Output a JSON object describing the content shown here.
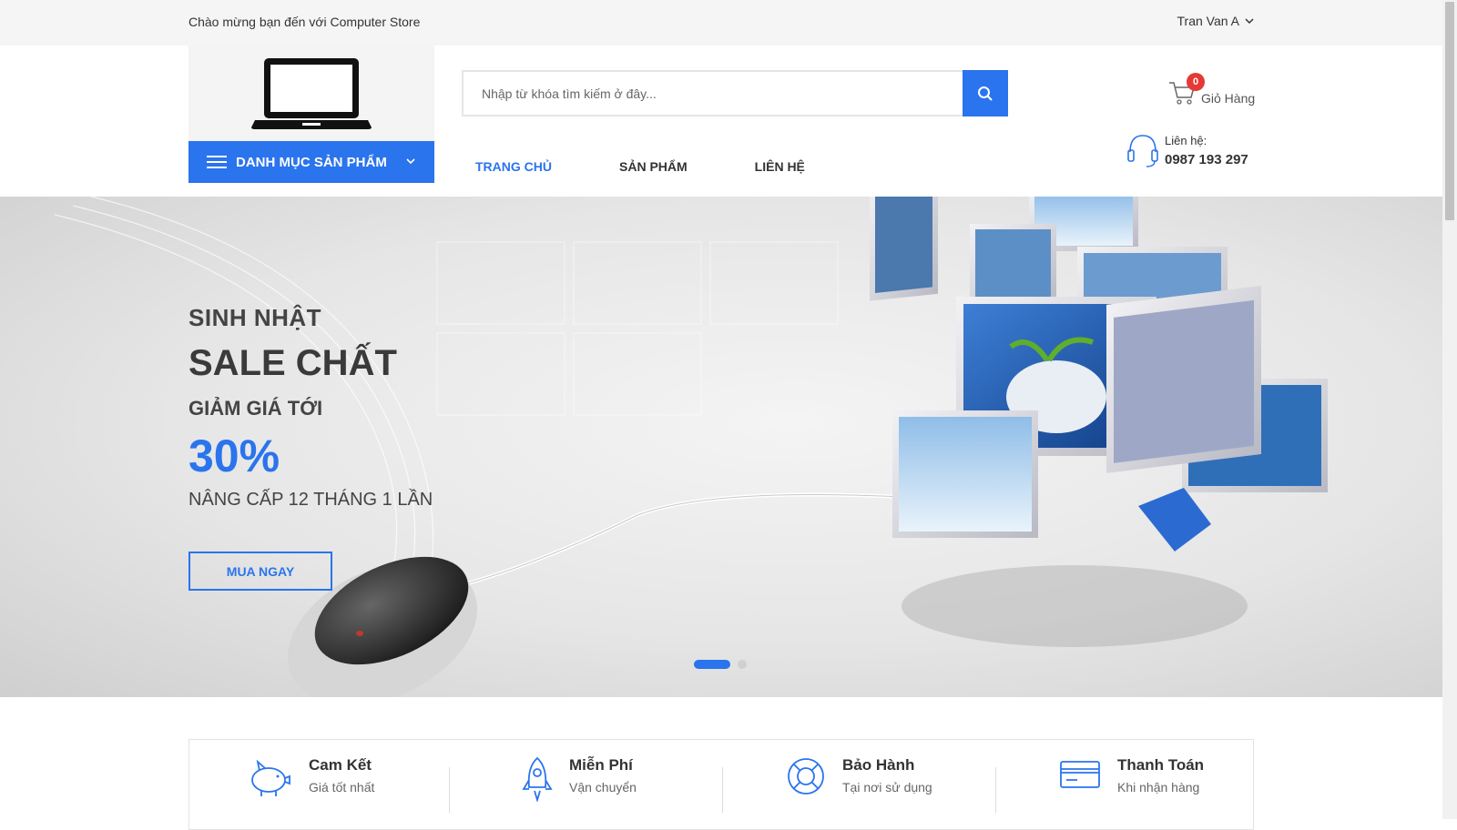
{
  "topbar": {
    "welcome": "Chào mừng bạn đến với Computer Store",
    "user_name": "Tran Van A"
  },
  "header": {
    "category_label": "DANH MỤC SẢN PHẨM",
    "search_placeholder": "Nhập từ khóa tìm kiếm ở đây...",
    "cart": {
      "count": "0",
      "label": "Giỏ Hàng"
    },
    "contact": {
      "label": "Liên hệ:",
      "phone": "0987 193 297"
    },
    "nav": [
      "TRANG CHỦ",
      "SẢN PHẨM",
      "LIÊN HỆ"
    ]
  },
  "banner": {
    "line1": "SINH NHẬT",
    "line2": "SALE CHẤT",
    "line3": "GIẢM GIÁ TỚI",
    "discount": "30%",
    "line5": "NÂNG CẤP 12 THÁNG 1 LẦN",
    "button": "MUA NGAY",
    "active_slide": 1,
    "slide_count": 2
  },
  "features": [
    {
      "title": "Cam Kết",
      "subtitle": "Giá tốt nhất",
      "icon": "piggy-bank-icon"
    },
    {
      "title": "Miễn Phí",
      "subtitle": "Vận chuyển",
      "icon": "rocket-icon"
    },
    {
      "title": "Bảo Hành",
      "subtitle": "Tại nơi sử dụng",
      "icon": "lifebuoy-icon"
    },
    {
      "title": "Thanh Toán",
      "subtitle": "Khi nhận hàng",
      "icon": "credit-card-icon"
    }
  ],
  "colors": {
    "accent": "#2a74ed",
    "badge": "#e53935"
  }
}
